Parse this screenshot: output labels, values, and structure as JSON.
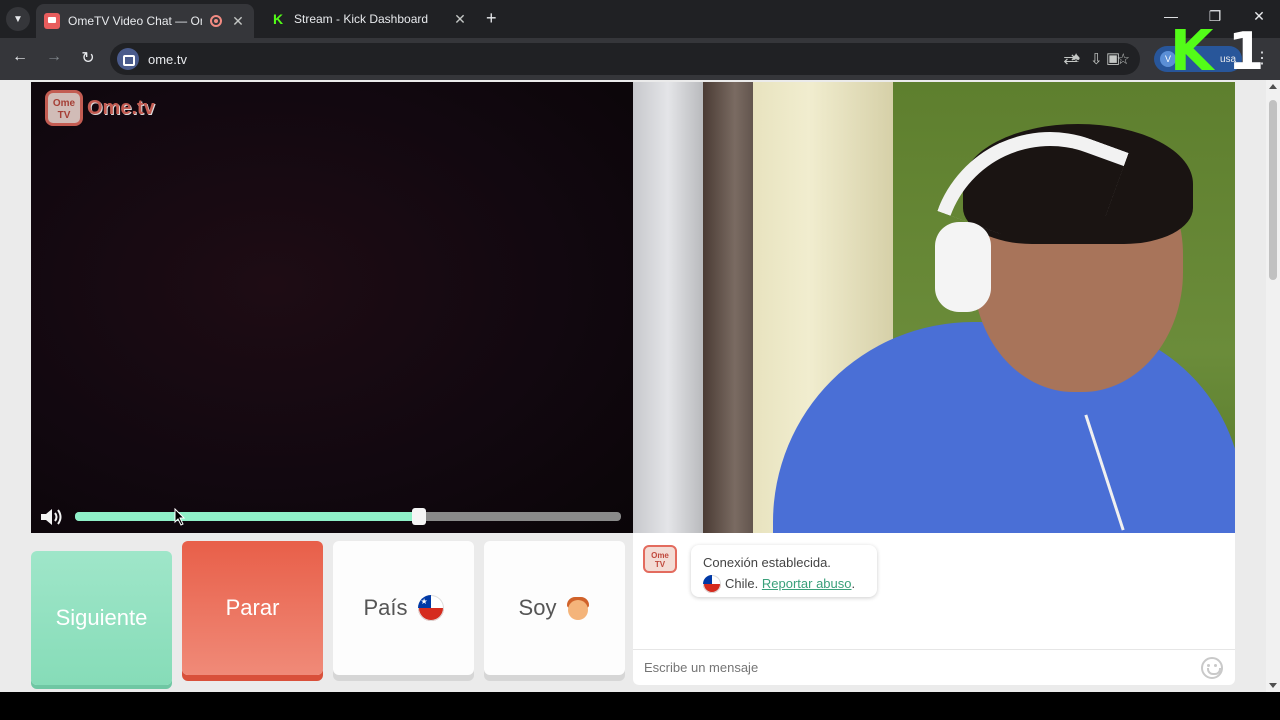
{
  "browser": {
    "tabs": [
      {
        "title": "OmeTV Video Chat — Ome",
        "active": true
      },
      {
        "title": "Stream - Kick Dashboard",
        "active": false
      }
    ],
    "new_tab": "+",
    "window_controls": {
      "minimize": "—",
      "restore": "❐",
      "close": "✕"
    },
    "url": "ome.tv",
    "profile_initial": "V",
    "profile_name": "usa",
    "overlay_logo": {
      "k": "K",
      "one": "1",
      "color": "#53fc18"
    }
  },
  "logo": {
    "badge_top": "Ome",
    "badge_bottom": "TV",
    "text": "Ome.tv"
  },
  "volume": {
    "level_percent": 63
  },
  "buttons": {
    "next": "Siguiente",
    "stop": "Parar",
    "country": "País",
    "gender": "Soy"
  },
  "chat": {
    "avatar_top": "Ome",
    "avatar_bottom": "TV",
    "message_line1": "Conexión establecida.",
    "country": "Chile.",
    "report_link": "Reportar abuso",
    "period": ".",
    "input_placeholder": "Escribe un mensaje"
  },
  "colors": {
    "next_green": "#86dcb8",
    "stop_red": "#e85f49",
    "link_green": "#3aa07a",
    "brand_red": "#e36b5e"
  }
}
